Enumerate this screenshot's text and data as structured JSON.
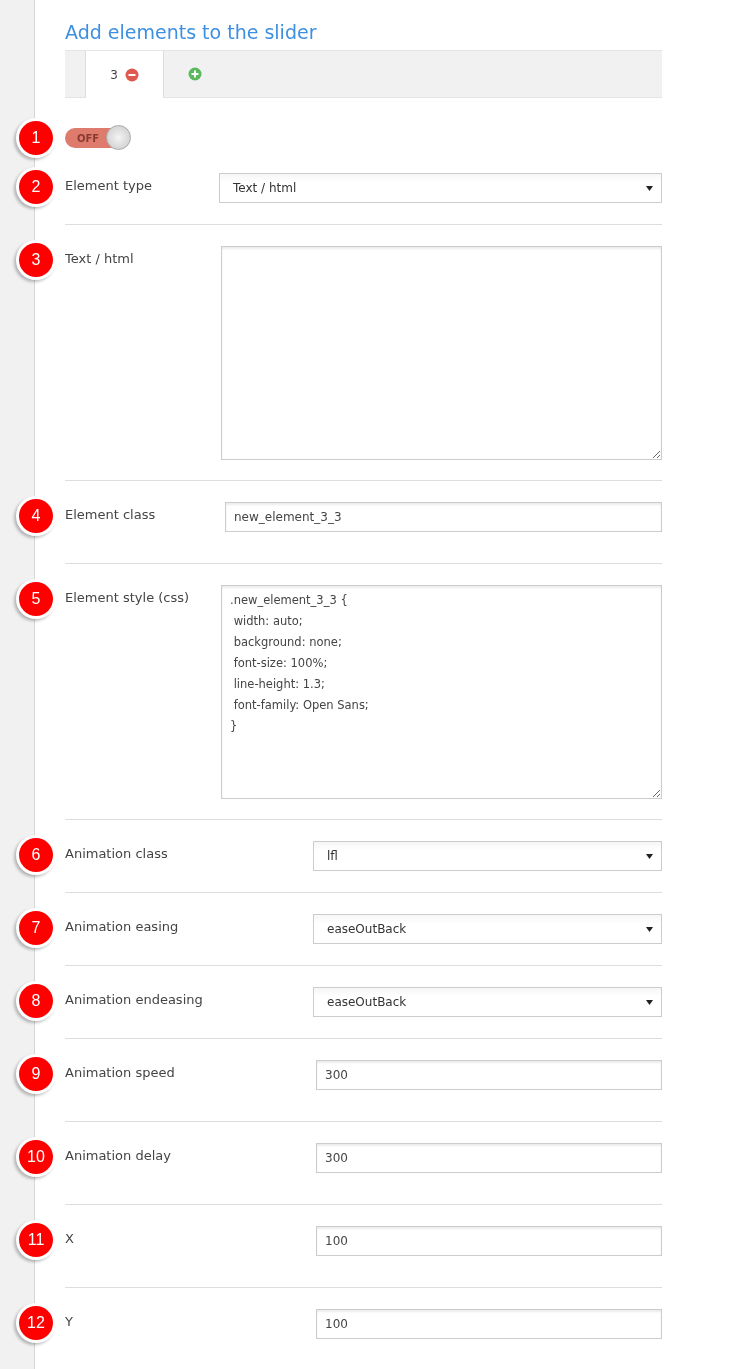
{
  "title": "Add elements to the slider",
  "tabs": [
    {
      "label": "3",
      "selected": true
    }
  ],
  "toggle": {
    "number": "1",
    "on": false,
    "label": "OFF"
  },
  "fields": [
    {
      "number": "2",
      "kind": "select",
      "label": "Element type",
      "value": "Text / html"
    },
    {
      "number": "3",
      "kind": "textarea",
      "label": "Text / html"
    },
    {
      "number": "4",
      "kind": "input",
      "label": "Element class",
      "value": "new_element_3_3"
    },
    {
      "number": "5",
      "kind": "textarea",
      "label": "Element style (css)",
      "value": ".new_element_3_3 {\n width: auto;\n background: none;\n font-size: 100%;\n line-height: 1.3;\n font-family: Open Sans;\n}"
    },
    {
      "number": "6",
      "kind": "select",
      "label": "Animation class",
      "value": "lfl"
    },
    {
      "number": "7",
      "kind": "select",
      "label": "Animation easing",
      "value": "easeOutBack"
    },
    {
      "number": "8",
      "kind": "select",
      "label": "Animation endeasing",
      "value": "easeOutBack"
    },
    {
      "number": "9",
      "kind": "input",
      "label": "Animation speed",
      "value": "300"
    },
    {
      "number": "10",
      "kind": "input",
      "label": "Animation delay",
      "value": "300"
    },
    {
      "number": "11",
      "kind": "input",
      "label": "X",
      "value": "100"
    },
    {
      "number": "12",
      "kind": "input",
      "label": "Y",
      "value": "100"
    }
  ]
}
